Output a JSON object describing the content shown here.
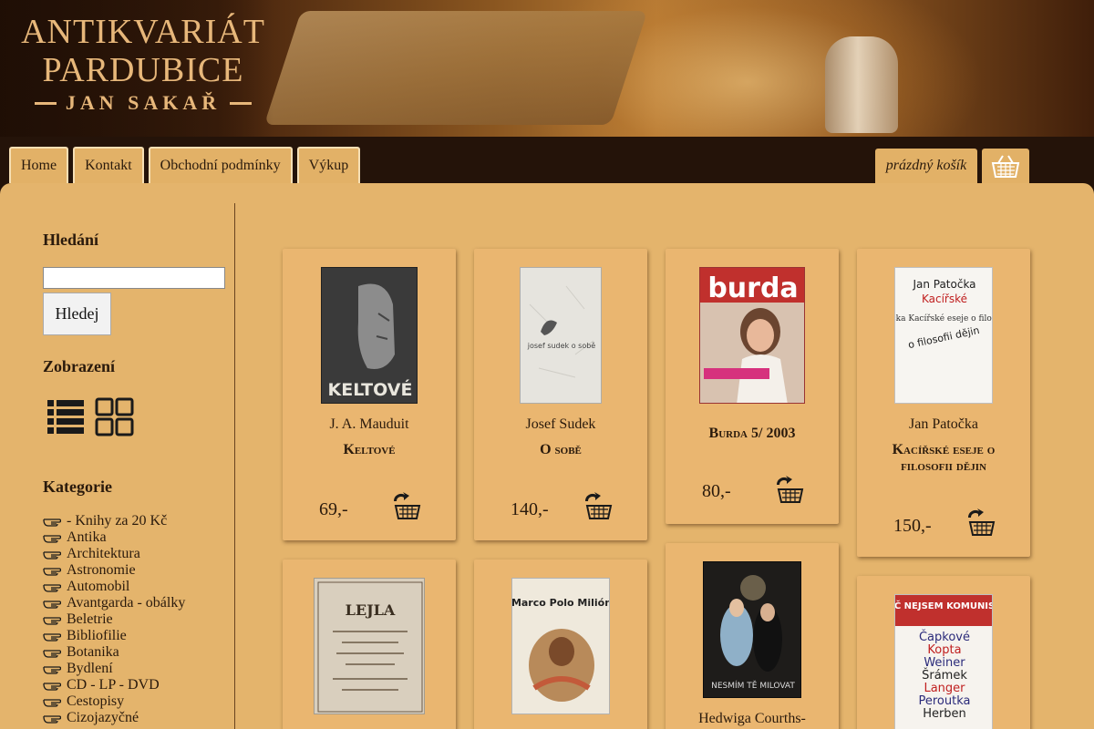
{
  "brand": {
    "line1": "ANTIKVARIÁT",
    "line2": "PARDUBICE",
    "line3": "JAN SAKAŘ"
  },
  "nav": [
    {
      "label": "Home"
    },
    {
      "label": "Kontakt"
    },
    {
      "label": "Obchodní podmínky"
    },
    {
      "label": "Výkup"
    }
  ],
  "cart": {
    "status": "prázdný košík",
    "icon": "basket-icon"
  },
  "sidebar": {
    "search_heading": "Hledání",
    "search_value": "",
    "search_button": "Hledej",
    "view_heading": "Zobrazení",
    "view_icons": [
      "list-view-icon",
      "grid-view-icon"
    ],
    "categories_heading": "Kategorie",
    "categories": [
      "- Knihy za 20 Kč",
      "Antika",
      "Architektura",
      "Astronomie",
      "Automobil",
      "Avantgarda - obálky",
      "Beletrie",
      "Bibliofilie",
      "Botanika",
      "Bydlení",
      "CD - LP - DVD",
      "Cestopisy",
      "Cizojazyčné"
    ]
  },
  "products": [
    {
      "author": "J. A. Mauduit",
      "title": "Keltové",
      "price": "69,-",
      "cover_text": "KELTOVÉ"
    },
    {
      "author": "Josef Sudek",
      "title": "O sobě",
      "price": "140,-",
      "cover_text": "josef sudek o sobě"
    },
    {
      "author": "",
      "title": "Burda 5/ 2003",
      "price": "80,-",
      "cover_text": "burda"
    },
    {
      "author": "Jan Patočka",
      "title": "Kacířské eseje o filosofii dějin",
      "price": "150,-",
      "cover_text": "Jan Patočka Kacířské eseje o filosofii dějin"
    },
    {
      "author": "",
      "title": "",
      "price": "",
      "cover_text": "LEJLA"
    },
    {
      "author": "",
      "title": "",
      "price": "",
      "cover_text": "Marco Polo Milión"
    },
    {
      "author": "Hedwiga Courths-",
      "title": "",
      "price": "",
      "cover_text": "NESMÍM TĚ MILOVAT"
    },
    {
      "author": "",
      "title": "",
      "price": "",
      "cover_text": "PROČ NEJSEM KOMUNISTOU"
    }
  ]
}
